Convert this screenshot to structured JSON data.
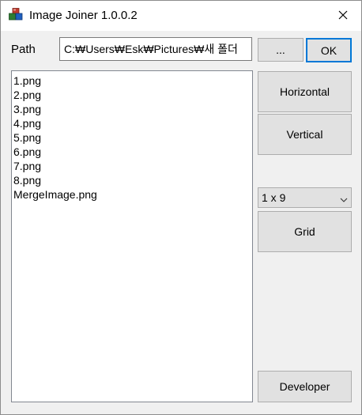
{
  "window": {
    "title": "Image Joiner 1.0.0.2",
    "app_icon": "image-joiner-app-icon",
    "close_icon": "close-icon"
  },
  "path": {
    "label": "Path",
    "value": "C:₩Users₩Esk₩Pictures₩새 폴더",
    "browse_label": "...",
    "ok_label": "OK"
  },
  "files": [
    "1.png",
    "2.png",
    "3.png",
    "4.png",
    "5.png",
    "6.png",
    "7.png",
    "8.png",
    "MergeImage.png"
  ],
  "actions": {
    "horizontal_label": "Horizontal",
    "vertical_label": "Vertical",
    "grid_selected": "1 x 9",
    "grid_label": "Grid",
    "developer_label": "Developer"
  },
  "colors": {
    "accent": "#0078d7",
    "button_bg": "#e1e1e1",
    "window_bg": "#f0f0f0"
  }
}
